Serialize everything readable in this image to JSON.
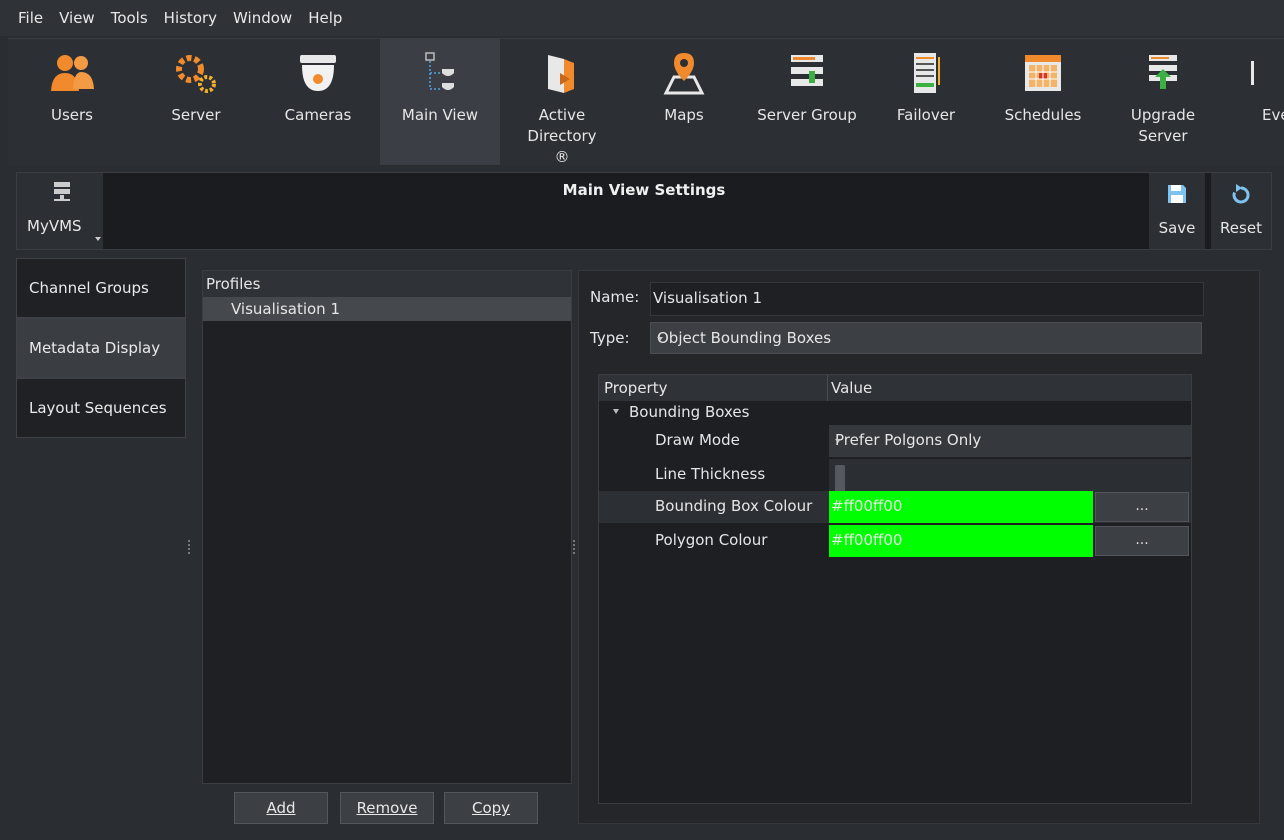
{
  "menu": [
    "File",
    "View",
    "Tools",
    "History",
    "Window",
    "Help"
  ],
  "toolbar": {
    "items": [
      {
        "label": "Users",
        "icon": "users-icon"
      },
      {
        "label": "Server",
        "icon": "server-gear-icon"
      },
      {
        "label": "Cameras",
        "icon": "dome-camera-icon"
      },
      {
        "label": "Main View",
        "icon": "main-view-icon",
        "active": true
      },
      {
        "label": "Active Directory ®",
        "icon": "active-directory-icon"
      },
      {
        "label": "Maps",
        "icon": "map-pin-icon"
      },
      {
        "label": "Server Group",
        "icon": "server-group-icon"
      },
      {
        "label": "Failover",
        "icon": "failover-icon"
      },
      {
        "label": "Schedules",
        "icon": "calendar-icon"
      },
      {
        "label": "Upgrade Server",
        "icon": "upgrade-server-icon"
      },
      {
        "label": "Eve",
        "icon": "events-icon"
      }
    ]
  },
  "settings_bar": {
    "server_label": "MyVMS",
    "title": "Main View Settings",
    "save_label": "Save",
    "reset_label": "Reset"
  },
  "left_nav": {
    "items": [
      {
        "label": "Channel Groups"
      },
      {
        "label": "Metadata Display",
        "active": true
      },
      {
        "label": "Layout Sequences"
      }
    ]
  },
  "profiles": {
    "header": "Profiles",
    "items": [
      "Visualisation 1"
    ],
    "add_label": "Add",
    "remove_label": "Remove",
    "copy_label": "Copy"
  },
  "details": {
    "name_label": "Name:",
    "name_value": "Visualisation 1",
    "type_label": "Type:",
    "type_value": "Object Bounding Boxes",
    "grid": {
      "col_property": "Property",
      "col_value": "Value",
      "group": "Bounding Boxes",
      "rows": [
        {
          "key": "Draw Mode",
          "value": "Prefer Polgons Only"
        },
        {
          "key": "Line Thickness",
          "value": "1"
        },
        {
          "key": "Bounding Box Colour",
          "value": "#ff00ff00",
          "button": "..."
        },
        {
          "key": "Polygon Colour",
          "value": "#ff00ff00",
          "button": "..."
        }
      ]
    }
  },
  "colors": {
    "accent_green": "#00ff00",
    "background": "#2a2d32",
    "icon_orange": "#f08a2c"
  }
}
